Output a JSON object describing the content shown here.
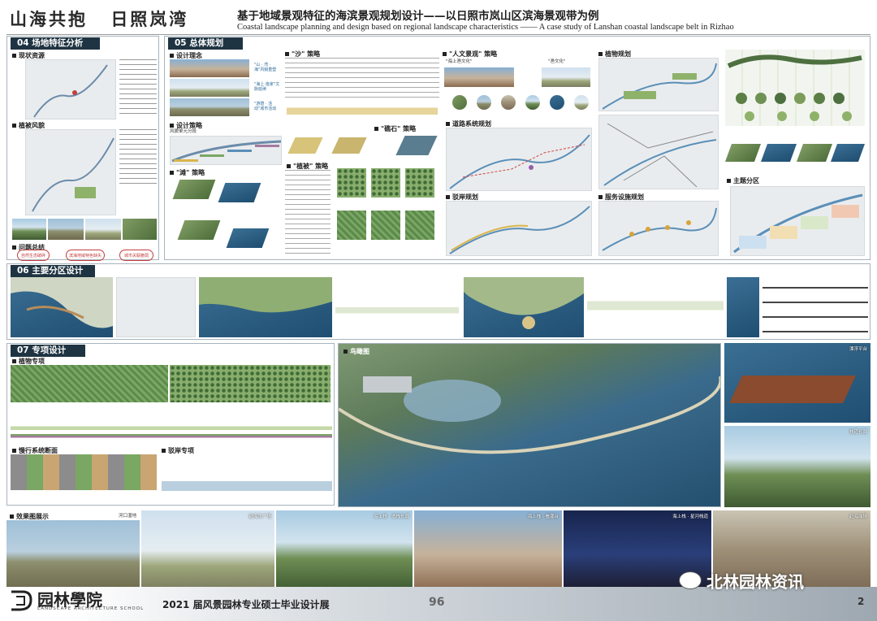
{
  "header": {
    "calligraphy_left": "山海共抱",
    "calligraphy_right": "日照岚湾",
    "title_cn": "基于地域景观特征的海滨景观规划设计——以日照市岚山区滨海景观带为例",
    "title_en": "Coastal landscape planning and design based on regional landscape characteristics —— A case study of  Lanshan coastal landscape belt in Rizhao"
  },
  "sections": {
    "s04": "04 场地特征分析",
    "s05": "05 总体规划",
    "s06": "06 主要分区设计",
    "s07": "07 专项设计"
  },
  "s04": {
    "status": "现状资源",
    "vegetation": "植被风貌",
    "problems": "问题总结",
    "bubbles": [
      "自然生态破碎",
      "滨海地域特色缺失",
      "城市关联脆弱"
    ]
  },
  "s05": {
    "concept": "设计理念",
    "concept_tags": [
      "\"山 · 湾 · 海\"风貌重塑",
      "\"海上·渔家\"文脉延续",
      "\"游憩 · 活动\"城市活动"
    ],
    "strategy": "设计策略",
    "strategy_sub": "风貌单元分段",
    "sand": "\"沙\" 策略",
    "reef": "\"礁石\" 策略",
    "beach": "\"滩\" 策略",
    "green": "\"植被\" 策略",
    "culture": "\"人文景观\" 策略",
    "culture_sub": [
      "\"海上渔文化\"",
      "\"渔文化\""
    ],
    "planting": "植物规划",
    "road": "道路系统规划",
    "shore": "驳岸规划",
    "service": "服务设施规划",
    "zoning": "主题分区"
  },
  "s07": {
    "plant": "植物专项",
    "slow": "慢行系统断面",
    "shore": "驳岸专项",
    "aerial": "鸟瞰图",
    "right_labels": [
      "漂浮平台",
      "栈道长廊"
    ]
  },
  "renders": {
    "title": "效果图展示",
    "labels": [
      "河口湿地",
      "赶海乐广场",
      "海上栈 · 造栈长廊",
      "海上栈 · 看潮台",
      "海上栈 · 星河栈道",
      "赶海泳场"
    ]
  },
  "footer": {
    "logo": "园林學院",
    "logo_sub": "LANDSCAPE  ARCHITECTURE SCHOOL",
    "show": "2021 届风景园林专业硕士毕业设计展",
    "page": "96",
    "watermark": "北林园林资讯",
    "corner": "2"
  },
  "colors": {
    "section_bar": "#1f3442",
    "panel_border": "#a8b4bd",
    "alert": "#c43d3d"
  }
}
